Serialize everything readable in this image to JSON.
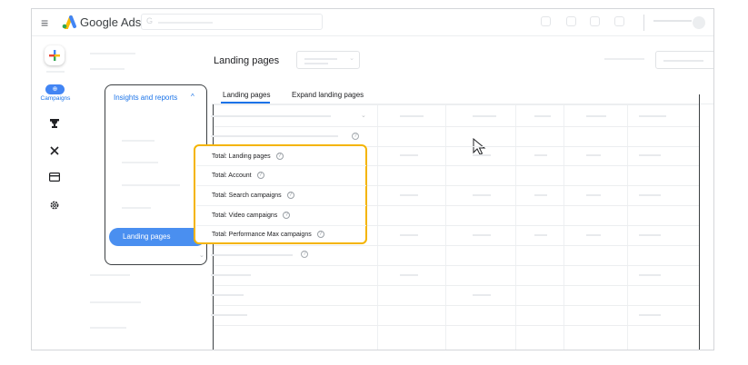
{
  "header": {
    "brand": "Google Ads",
    "menu_icon": "menu-icon",
    "search_icon": "google-g-icon",
    "search_glyph": "G"
  },
  "rail": {
    "create_icon": "plus-icon",
    "campaigns_glyph": "⊕",
    "campaigns_label": "Campaigns",
    "icons": [
      "trophy-icon",
      "tools-icon",
      "billing-card-icon",
      "settings-gear-icon"
    ]
  },
  "nav": {
    "section_title": "Insights and reports",
    "section_chevron": "^",
    "active_item": "Landing pages"
  },
  "page": {
    "title": "Landing pages",
    "tabs": [
      {
        "label": "Landing pages",
        "active": true
      },
      {
        "label": "Expand landing pages",
        "active": false
      }
    ]
  },
  "totals": {
    "help_glyph": "?",
    "rows": [
      "Total: Landing pages",
      "Total: Account",
      "Total: Search campaigns",
      "Total: Video campaigns",
      "Total: Performance Max campaigns"
    ],
    "highlight_color": "#f4b400"
  },
  "colors": {
    "accent": "#1a73e8",
    "active_pill": "#4a8ff0"
  }
}
